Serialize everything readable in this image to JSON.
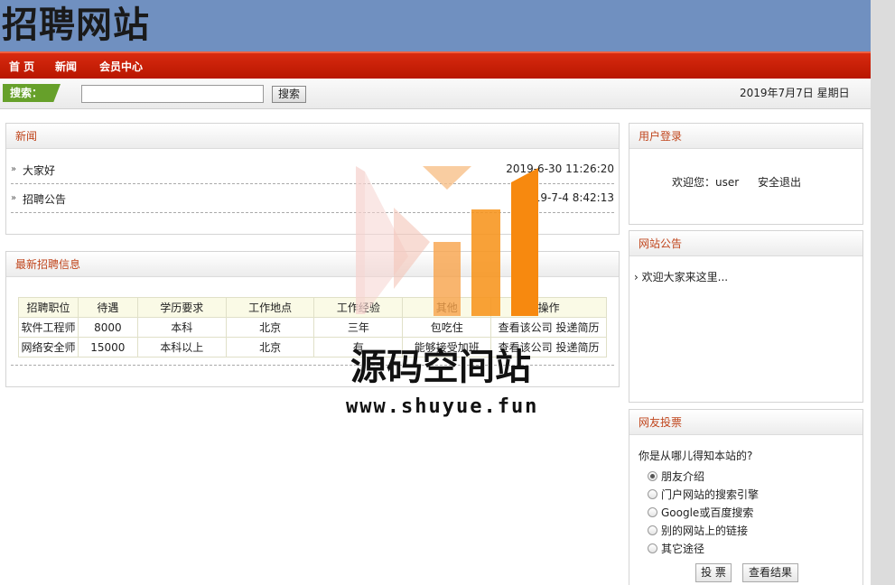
{
  "header": {
    "logo": "招聘网站"
  },
  "nav": {
    "items": [
      "首 页",
      "新闻",
      "会员中心"
    ]
  },
  "search": {
    "label": "搜索：",
    "value": "",
    "placeholder": "",
    "button": "搜索"
  },
  "date": "2019年7月7日 星期日",
  "news": {
    "title": "新闻",
    "items": [
      {
        "title": "大家好",
        "time": "2019-6-30 11:26:20"
      },
      {
        "title": "招聘公告",
        "time": "2019-7-4 8:42:13"
      }
    ]
  },
  "jobs": {
    "title": "最新招聘信息",
    "headers": [
      "招聘职位",
      "待遇",
      "学历要求",
      "工作地点",
      "工作经验",
      "其他",
      "操作"
    ],
    "rows": [
      [
        "软件工程师",
        "8000",
        "本科",
        "北京",
        "三年",
        "包吃住",
        "查看该公司 投递简历"
      ],
      [
        "网络安全师",
        "15000",
        "本科以上",
        "北京",
        "有",
        "能够接受加班",
        "查看该公司 投递简历"
      ]
    ]
  },
  "login": {
    "title": "用户登录",
    "welcome": "欢迎您：user",
    "logout": "安全退出"
  },
  "notice": {
    "title": "网站公告",
    "item": "欢迎大家来这里..."
  },
  "vote": {
    "title": "网友投票",
    "question": "你是从哪儿得知本站的?",
    "options": [
      "朋友介绍",
      "门户网站的搜索引擎",
      "Google或百度搜索",
      "别的网站上的链接",
      "其它途径"
    ],
    "submit": "投 票",
    "results": "查看结果"
  },
  "watermark": {
    "title": "源码空间站",
    "url": "www.shuyue.fun"
  },
  "colors": {
    "header_bg": "#7090c0",
    "nav_bg": "#c81e06",
    "search_label_bg": "#66a02a",
    "panel_title": "#c0451c",
    "wm_orange": "#f7941d"
  }
}
